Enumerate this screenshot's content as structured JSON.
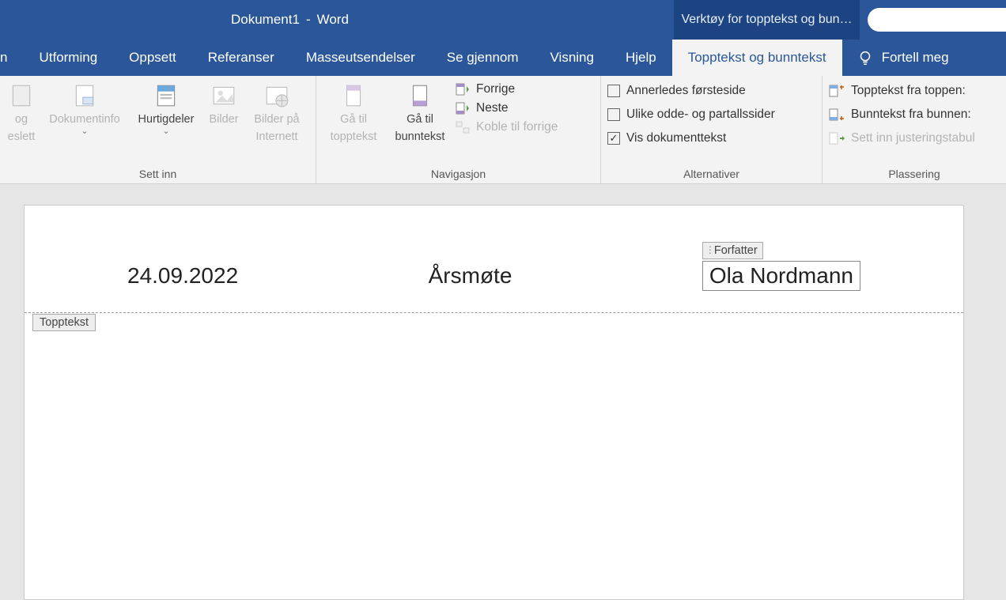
{
  "title": {
    "doc": "Dokument1",
    "sep": "-",
    "app": "Word"
  },
  "tool_tab_title": "Verktøy for topptekst og bun…",
  "tabs": {
    "partial_left": "n",
    "utforming": "Utforming",
    "oppsett": "Oppsett",
    "referanser": "Referanser",
    "masseutsendelser": "Masseutsendelser",
    "se_gjennom": "Se gjennom",
    "visning": "Visning",
    "hjelp": "Hjelp",
    "topptekst": "Topptekst og bunntekst",
    "tell_me": "Fortell meg"
  },
  "ribbon": {
    "sett_inn": {
      "label": "Sett inn",
      "og_slett_line1": "og",
      "og_slett_line2": "eslett",
      "dokumentinfo": "Dokumentinfo",
      "hurtigdeler": "Hurtigdeler",
      "bilder": "Bilder",
      "bilder_pa_internett_line1": "Bilder på",
      "bilder_pa_internett_line2": "Internett"
    },
    "navigasjon": {
      "label": "Navigasjon",
      "ga_til_topptekst_line1": "Gå til",
      "ga_til_topptekst_line2": "topptekst",
      "ga_til_bunntekst_line1": "Gå til",
      "ga_til_bunntekst_line2": "bunntekst",
      "forrige": "Forrige",
      "neste": "Neste",
      "koble_til_forrige": "Koble til forrige"
    },
    "alternativer": {
      "label": "Alternativer",
      "annerledes": "Annerledes førsteside",
      "ulike": "Ulike odde- og partallssider",
      "vis_dok": "Vis dokumenttekst"
    },
    "plassering": {
      "label": "Plassering",
      "topptekst_fra_toppen": "Topptekst fra toppen:",
      "bunntekst_fra_bunnen": "Bunntekst fra bunnen:",
      "sett_inn_tab": "Sett inn justeringstabul"
    }
  },
  "document": {
    "date": "24.09.2022",
    "title": "Årsmøte",
    "author_label": "Forfatter",
    "author_value": "Ola Nordmann",
    "header_tag": "Topptekst"
  }
}
